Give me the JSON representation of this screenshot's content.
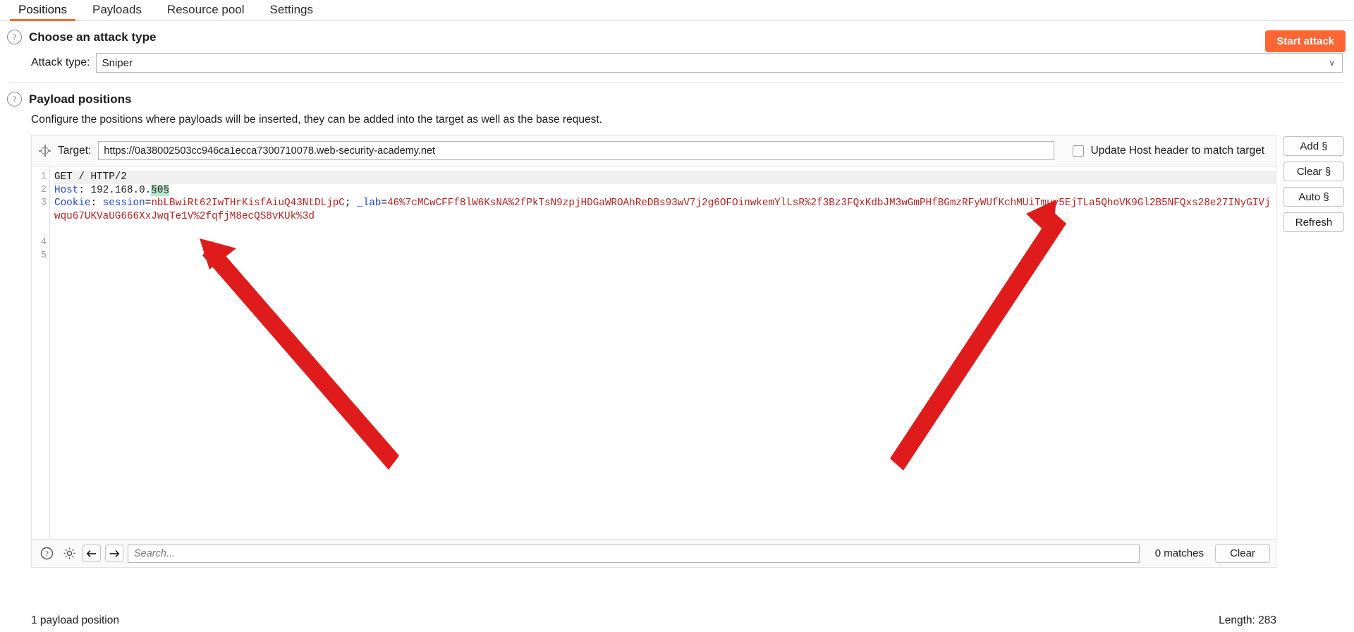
{
  "tabs": [
    {
      "label": "Positions",
      "active": true
    },
    {
      "label": "Payloads",
      "active": false
    },
    {
      "label": "Resource pool",
      "active": false
    },
    {
      "label": "Settings",
      "active": false
    }
  ],
  "start_attack_label": "Start attack",
  "attack_section": {
    "title": "Choose an attack type",
    "help_glyph": "?",
    "attack_type_label": "Attack type:",
    "attack_type_value": "Sniper",
    "caret_glyph": "∨"
  },
  "positions_section": {
    "title": "Payload positions",
    "help_glyph": "?",
    "description": "Configure the positions where payloads will be inserted, they can be added into the target as well as the base request."
  },
  "target": {
    "label": "Target:",
    "value": "https://0a38002503cc946ca1ecca7300710078.web-security-academy.net",
    "checkbox_label": "Update Host header to match target",
    "checkbox_checked": false
  },
  "side_buttons": [
    {
      "label": "Add §"
    },
    {
      "label": "Clear §"
    },
    {
      "label": "Auto §"
    },
    {
      "label": "Refresh"
    }
  ],
  "editor": {
    "line_numbers": [
      "1",
      "2",
      "3",
      "",
      "",
      "4",
      "5"
    ],
    "request": {
      "line1_method": "GET / HTTP/2",
      "line2_header": "Host",
      "line2_sep": ": ",
      "line2_value": "192.168.0.",
      "line2_marker": "§0§",
      "line3_header": "Cookie",
      "line3_sep": ": ",
      "line3_name": "session",
      "line3_eq": "=",
      "line3_value": "nbLBwiRt62IwTHrKisfAiuQ43NtDLjpC",
      "line3_semi": "; ",
      "line3_name2": "_lab",
      "line3_eq2": "=",
      "line3_value2": "46%7cMCwCFFf8lW6KsNA%2fPkTsN9zpjHDGaWROAhReDBs93wV7j2g6OFOinwkemYlLsR%2f3Bz3FQxKdbJM3wGmPHfBGmzRFyWUfKchMUiTmuv5EjTLa5QhoVK9Gl2B5NFQxs28e27INyGIVjwqu67UKVaUG666XxJwqTe1V%2fqfjM8ecQS8vKUk%3d"
    }
  },
  "search": {
    "placeholder": "Search...",
    "value": "",
    "matches_label": "0 matches",
    "clear_label": "Clear",
    "help_icon": "help-circle-icon",
    "settings_icon": "gear-icon",
    "prev_icon": "arrow-left-icon",
    "next_icon": "arrow-right-icon"
  },
  "status": {
    "left": "1 payload position",
    "right": "Length: 283"
  },
  "colors": {
    "accent": "#ff6633",
    "marker_highlight": "#b9e6cf",
    "header_blue": "#2244cc",
    "value_red": "#b22222",
    "annotation_arrow": "#e01b1b"
  }
}
